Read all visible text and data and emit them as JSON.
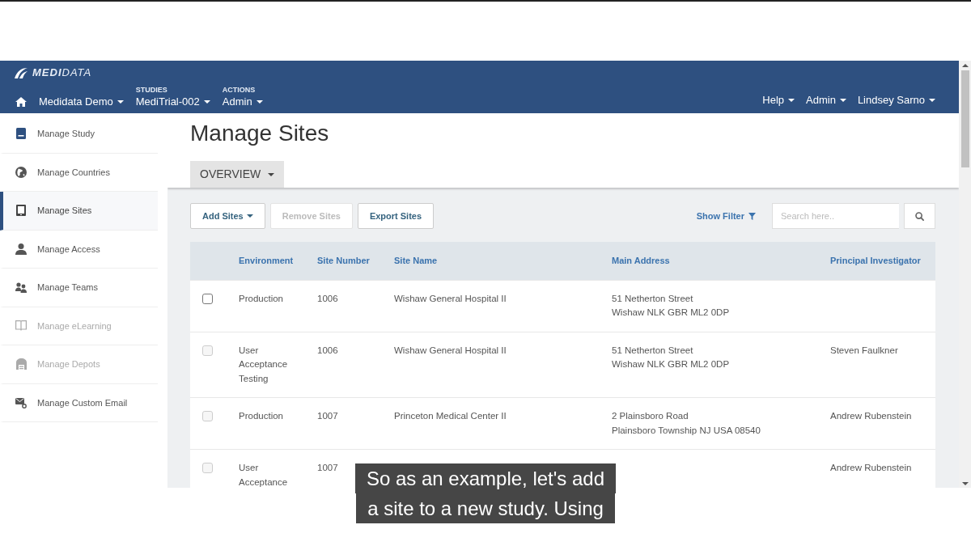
{
  "header": {
    "logo_text": "**MEDI**DATA",
    "nav": [
      {
        "label": "Medidata Demo"
      },
      {
        "caption": "STUDIES",
        "label": "MediTrial-002"
      },
      {
        "caption": "ACTIONS",
        "label": "Admin"
      }
    ],
    "right_menu": [
      {
        "label": "Help"
      },
      {
        "label": "Admin"
      },
      {
        "label": "Lindsey Sarno"
      }
    ]
  },
  "sidebar": {
    "items": [
      {
        "label": "Manage Study",
        "selected": false,
        "disabled": false
      },
      {
        "label": "Manage Countries",
        "selected": false,
        "disabled": false
      },
      {
        "label": "Manage Sites",
        "selected": true,
        "disabled": false
      },
      {
        "label": "Manage Access",
        "selected": false,
        "disabled": false
      },
      {
        "label": "Manage Teams",
        "selected": false,
        "disabled": false
      },
      {
        "label": "Manage eLearning",
        "selected": false,
        "disabled": true
      },
      {
        "label": "Manage Depots",
        "selected": false,
        "disabled": true
      },
      {
        "label": "Manage Custom Email",
        "selected": false,
        "disabled": false
      }
    ]
  },
  "page": {
    "title": "Manage Sites",
    "tabs": [
      {
        "label": "OVERVIEW",
        "selected": true
      }
    ]
  },
  "toolbar": {
    "buttons": [
      {
        "label": "Add Sites",
        "kind": "dropdown",
        "disabled": false
      },
      {
        "label": "Remove Sites",
        "kind": "plain",
        "disabled": true
      },
      {
        "label": "Export Sites",
        "kind": "plain",
        "disabled": false
      }
    ],
    "filter_link": "Show Filter",
    "search": {
      "placeholder": "Search here.."
    }
  },
  "table": {
    "columns": [
      "Environment",
      "Site Number",
      "Site Name",
      "Main Address",
      "Principal Investigator"
    ],
    "rows": [
      {
        "checked": false,
        "disabled": false,
        "environment": "Production",
        "site_number": "1006",
        "site_name": "Wishaw General Hospital II",
        "main_address": [
          "51 Netherton Street",
          "Wishaw NLK GBR ML2 0DP"
        ]
      },
      {
        "checked": false,
        "disabled": true,
        "environment": "User Acceptance Testing",
        "site_number": "1006",
        "site_name": "Wishaw General Hospital II",
        "main_address": [
          "51 Netherton Street",
          "Wishaw NLK GBR ML2 0DP"
        ],
        "principal_investigator": "Steven Faulkner"
      },
      {
        "checked": false,
        "disabled": true,
        "environment": "Production",
        "site_number": "1007",
        "site_name": "Princeton Medical Center II",
        "main_address": [
          "2 Plainsboro Road",
          "Plainsboro Township NJ USA 08540"
        ],
        "principal_investigator": "Andrew Rubenstein"
      },
      {
        "checked": false,
        "disabled": true,
        "environment": "User Acceptance",
        "site_number": "1007",
        "principal_investigator": "Andrew Rubenstein"
      }
    ]
  },
  "caption": {
    "lines": [
      "So as an example, let's add",
      "a site to a new study. Using"
    ]
  }
}
